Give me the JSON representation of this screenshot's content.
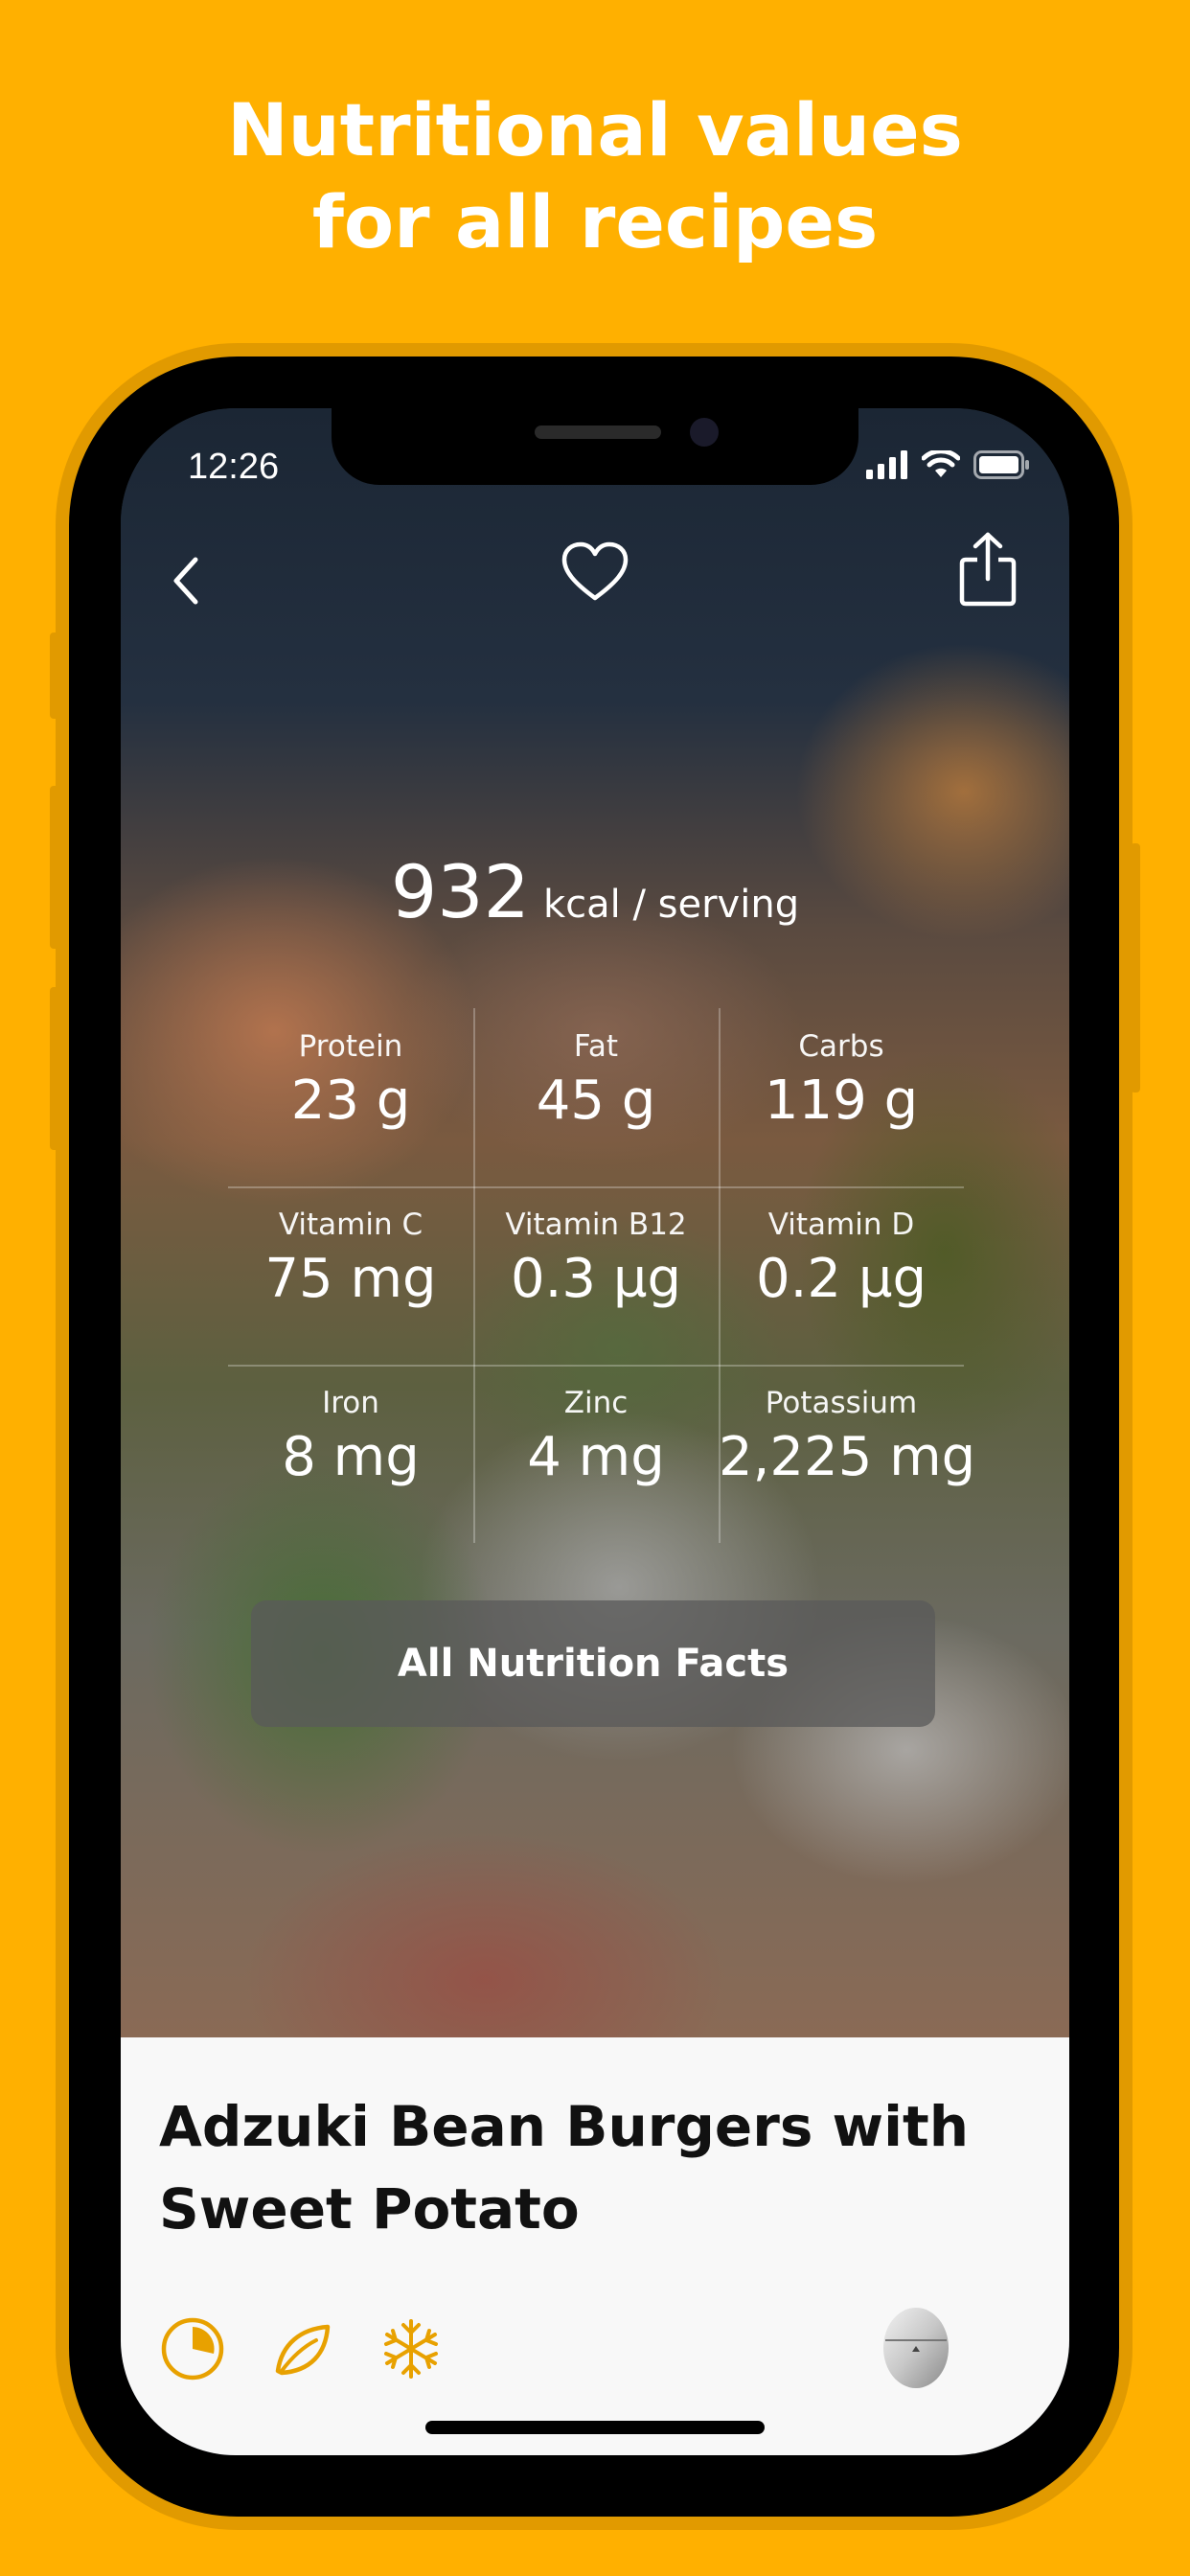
{
  "headline": {
    "line1": "Nutritional values",
    "line2": "for all recipes"
  },
  "status_bar": {
    "time": "12:26",
    "icons": [
      "cellular-signal-icon",
      "wifi-icon",
      "battery-icon"
    ]
  },
  "nav": {
    "back_icon": "chevron-left-icon",
    "favorite_icon": "heart-icon",
    "share_icon": "share-icon"
  },
  "nutrition": {
    "calories": "932",
    "calories_unit": "kcal / serving",
    "items": [
      {
        "label": "Protein",
        "value": "23 g"
      },
      {
        "label": "Fat",
        "value": "45 g"
      },
      {
        "label": "Carbs",
        "value": "119 g"
      },
      {
        "label": "Vitamin C",
        "value": "75 mg"
      },
      {
        "label": "Vitamin B12",
        "value": "0.3 µg"
      },
      {
        "label": "Vitamin D",
        "value": "0.2 µg"
      },
      {
        "label": "Iron",
        "value": "8 mg"
      },
      {
        "label": "Zinc",
        "value": "4 mg"
      },
      {
        "label": "Potassium",
        "value": "2,225 mg"
      }
    ],
    "all_facts_label": "All Nutrition Facts"
  },
  "recipe": {
    "title": "Adzuki Bean Burgers with Sweet Potato",
    "tags": [
      "quick-time-icon",
      "vegan-leaf-icon",
      "freezable-snowflake-icon"
    ],
    "timer_icon": "egg-timer-icon"
  },
  "colors": {
    "background": "#FFB000",
    "accent": "#E8A100",
    "text_dark": "#111111"
  }
}
